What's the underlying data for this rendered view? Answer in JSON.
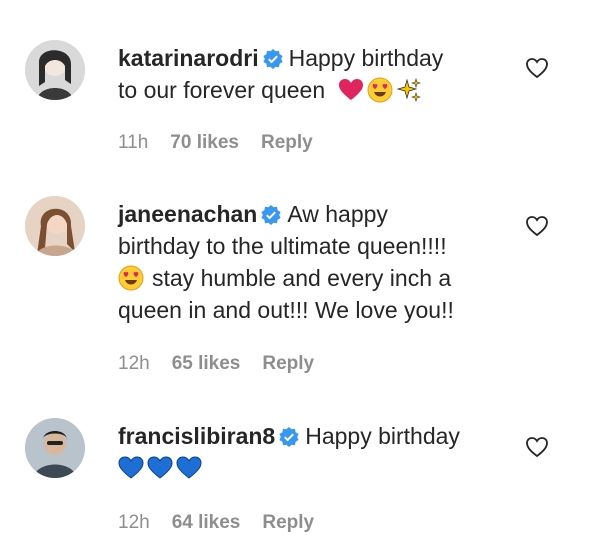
{
  "comments": [
    {
      "username": "katarinarodri",
      "text_line1": "Happy birthday",
      "text_line2": "to our forever queen",
      "emojis": [
        "red-heart-emoji",
        "heart-eyes-emoji",
        "sparkles-emoji"
      ],
      "time": "11h",
      "likes": "70 likes",
      "reply": "Reply"
    },
    {
      "username": "janeenachan",
      "text_line1": "Aw happy",
      "text_line2": "birthday to the ultimate queen!!!!",
      "text_line3": "stay humble and every inch a",
      "text_line4": "queen in and out!!! We love you!!",
      "emojis": [
        "heart-eyes-emoji"
      ],
      "time": "12h",
      "likes": "65 likes",
      "reply": "Reply"
    },
    {
      "username": "francislibiran8",
      "text_line1": "Happy birthday",
      "emojis": [
        "blue-heart-emoji",
        "blue-heart-emoji",
        "blue-heart-emoji"
      ],
      "time": "12h",
      "likes": "64 likes",
      "reply": "Reply"
    }
  ],
  "colors": {
    "text": "#262626",
    "meta": "#8e8e8e",
    "verified": "#3897f0",
    "red_heart": "#e0245e",
    "blue_heart": "#1d6fd6"
  }
}
